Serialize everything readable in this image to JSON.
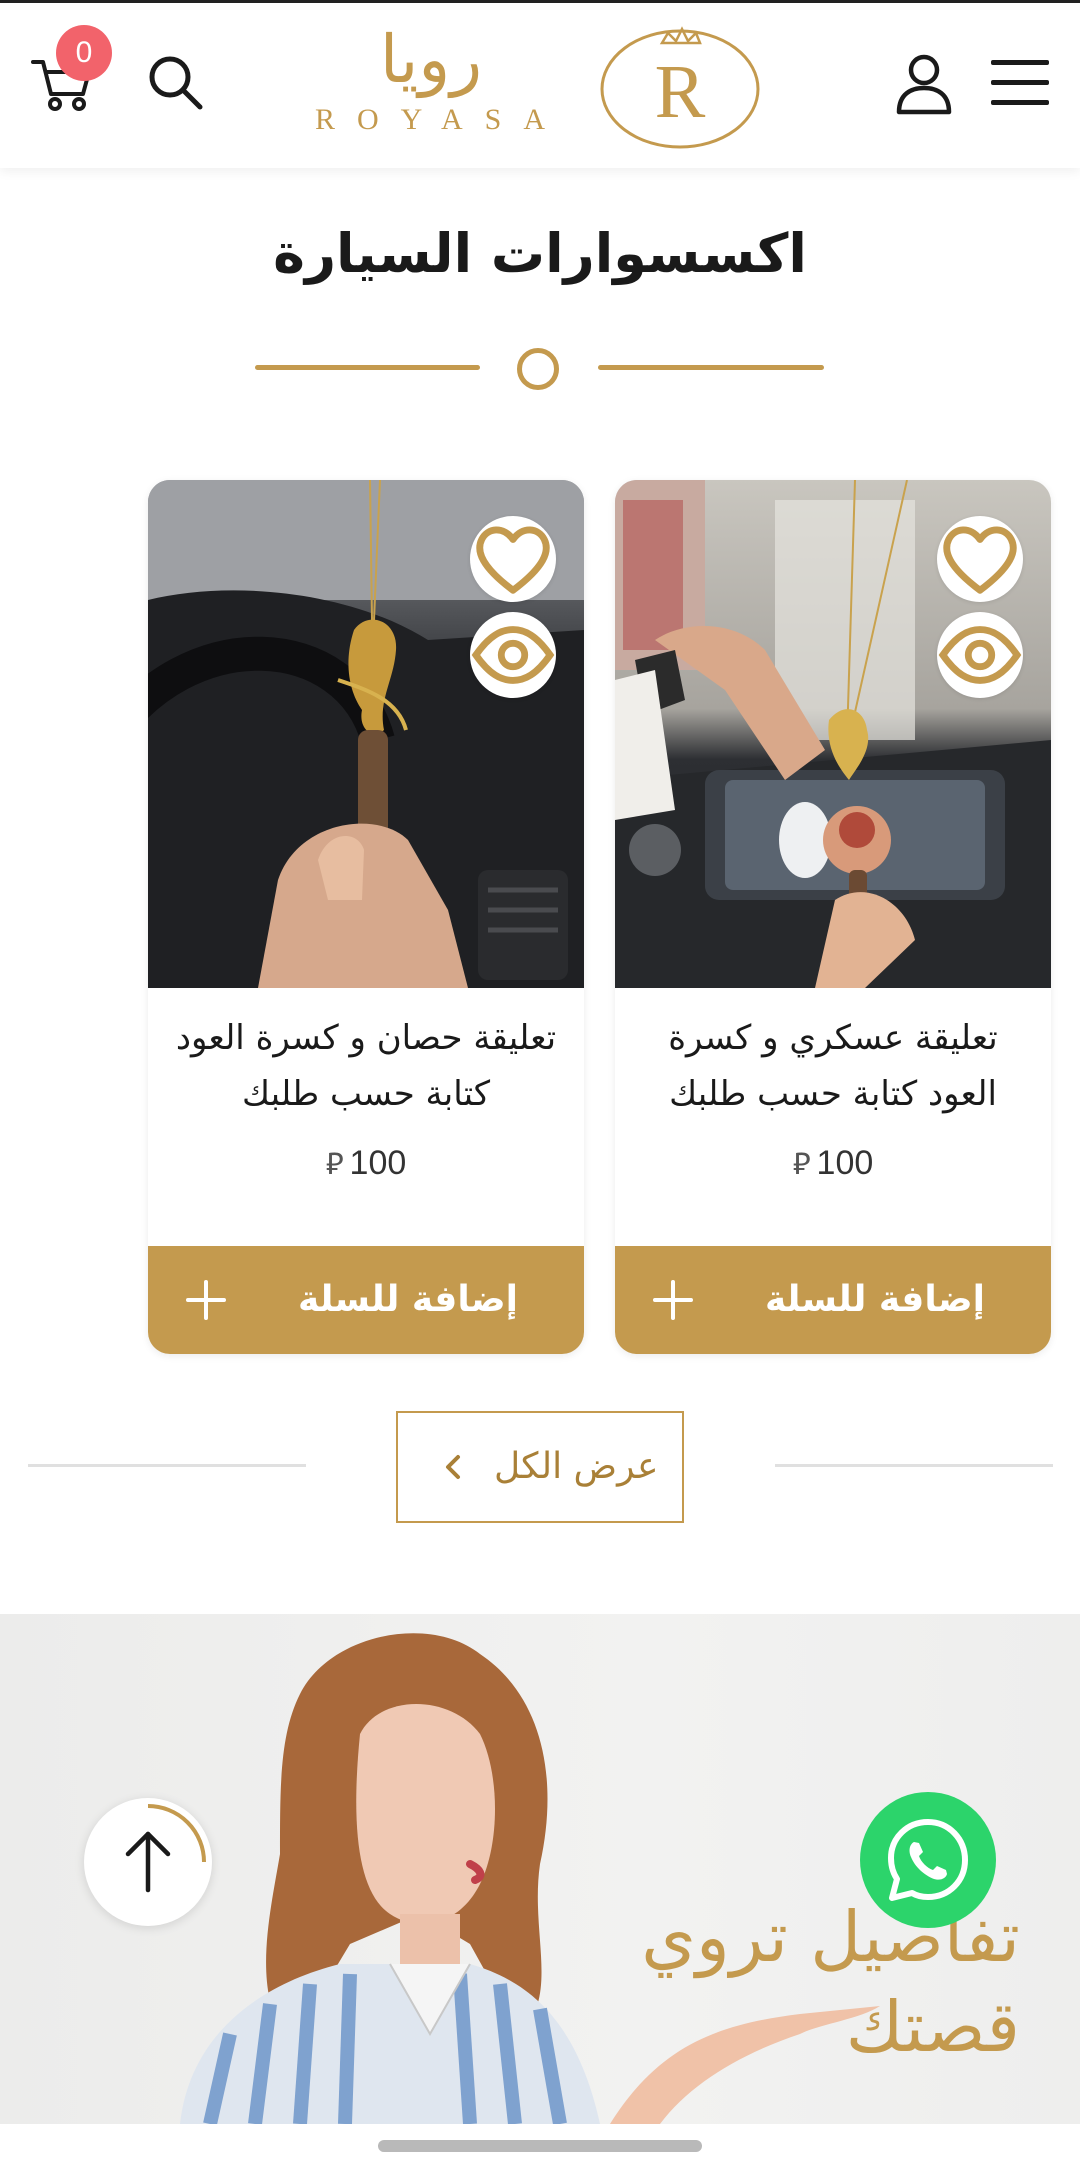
{
  "header": {
    "cart_count": "0",
    "logo_arabic": "رويا",
    "logo_latin": "ROYASA",
    "logo_mark_letter": "R"
  },
  "section": {
    "title": "اكسسوارات السيارة"
  },
  "products": [
    {
      "title": "تعليقة عسكري و كسرة العود كتابة حسب طلبك",
      "price": "100",
      "currency_symbol": "⃁",
      "add_to_cart_label": "إضافة للسلة"
    },
    {
      "title": "تعليقة حصان و كسرة العود كتابة حسب طلبك",
      "price": "100",
      "currency_symbol": "⃁",
      "add_to_cart_label": "إضافة للسلة"
    }
  ],
  "view_all": {
    "label": "عرض الكل"
  },
  "banner": {
    "text": "تفاصيل تروي قصتك"
  },
  "colors": {
    "accent_gold": "#c49a4e",
    "badge_red": "#f2636b",
    "whatsapp_green": "#2cd46b"
  },
  "icons": {
    "cart": "cart-icon",
    "search": "search-icon",
    "user": "user-icon",
    "menu": "menu-icon",
    "favorite": "heart-icon",
    "quick_view": "eye-icon",
    "add": "plus-icon",
    "chevron": "chevron-left-icon",
    "scroll_top": "arrow-up-icon",
    "whatsapp": "whatsapp-icon"
  }
}
